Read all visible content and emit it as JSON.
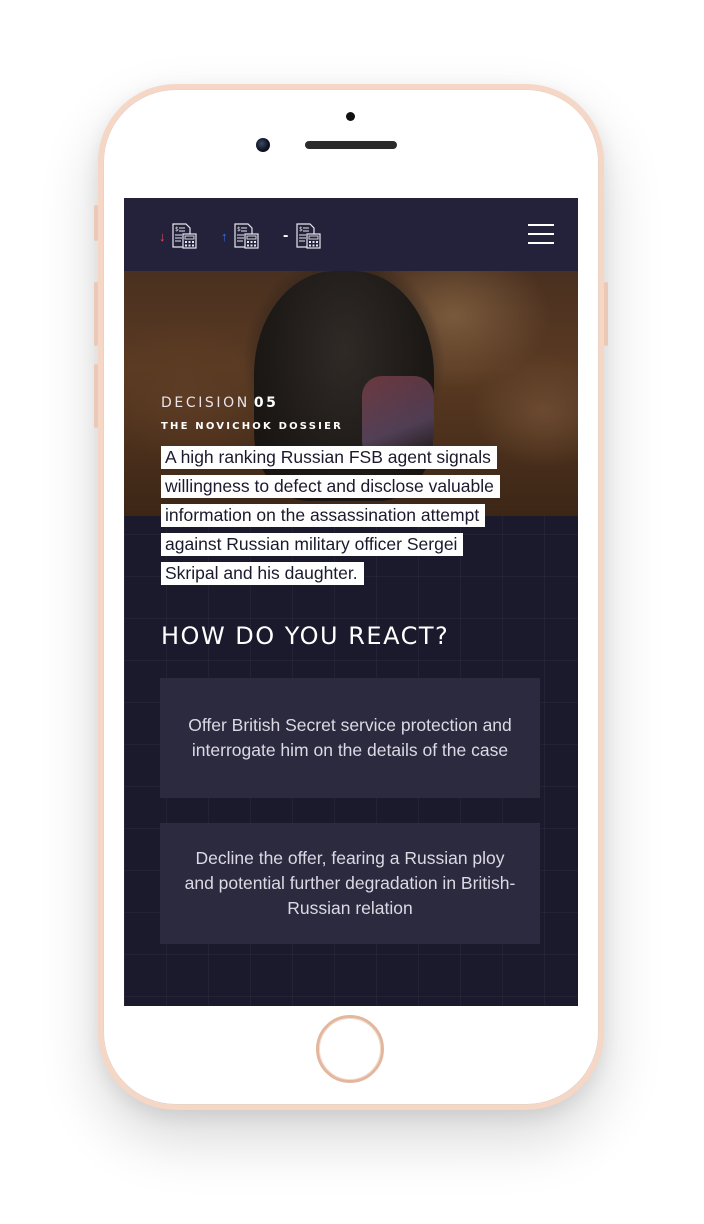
{
  "topbar": {
    "stats": [
      {
        "direction": "down",
        "arrow": "↓",
        "icon": "calculator-document-icon",
        "color": "#e94a5c"
      },
      {
        "direction": "up",
        "arrow": "↑",
        "icon": "calculator-document-icon",
        "color": "#3a6ef0"
      },
      {
        "direction": "neutral",
        "arrow": "-",
        "icon": "calculator-document-icon",
        "color": "#ffffff"
      }
    ],
    "menu_icon": "hamburger-menu-icon"
  },
  "decision": {
    "label": "DECISION",
    "number": "05",
    "case_title": "THE NOVICHOK DOSSIER",
    "intro_lines": [
      "A high ranking Russian FSB agent signals",
      "willingness to defect and disclose valuable",
      "information on the assassination attempt",
      "against Russian military officer Sergei",
      "Skripal and his daughter."
    ]
  },
  "question": "HOW DO YOU REACT?",
  "options": [
    {
      "label": "Offer British Secret service protection and interrogate him on the details of the case"
    },
    {
      "label": "Decline the offer, fearing a Russian ploy and potential further degradation in British-Russian relation"
    }
  ],
  "colors": {
    "background": "#1b1a2d",
    "topbar": "#23223a",
    "option_bg": "#2b2a3f",
    "down": "#e94a5c",
    "up": "#3a6ef0"
  }
}
